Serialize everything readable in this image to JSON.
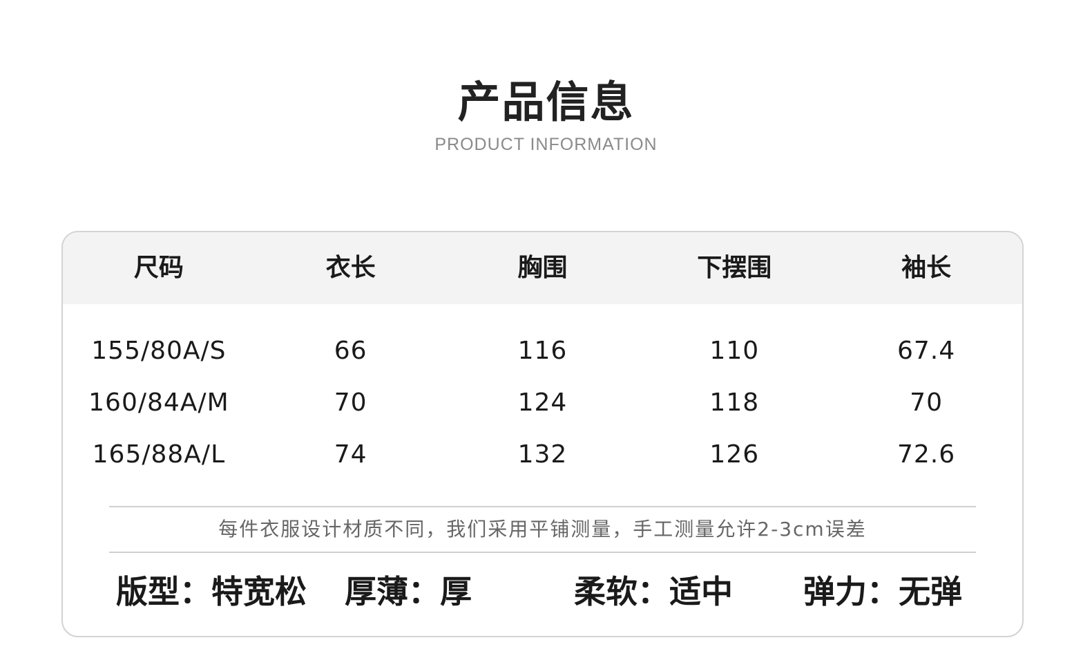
{
  "header": {
    "title": "产品信息",
    "subtitle": "PRODUCT INFORMATION"
  },
  "table": {
    "columns": [
      "尺码",
      "衣长",
      "胸围",
      "下摆围",
      "袖长"
    ],
    "rows": [
      [
        "155/80A/S",
        "66",
        "116",
        "110",
        "67.4"
      ],
      [
        "160/84A/M",
        "70",
        "124",
        "118",
        "70"
      ],
      [
        "165/88A/L",
        "74",
        "132",
        "126",
        "72.6"
      ]
    ]
  },
  "note": "每件衣服设计材质不同，我们采用平铺测量，手工测量允许2-3cm误差",
  "attributes": [
    "版型：特宽松",
    "厚薄：厚",
    "柔软：适中",
    "弹力：无弹"
  ]
}
